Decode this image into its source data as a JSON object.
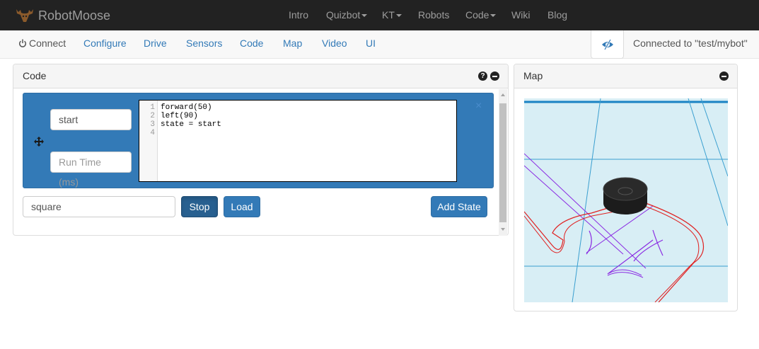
{
  "app": {
    "brand": "RobotMoose"
  },
  "topnav": {
    "intro": "Intro",
    "quizbot": "Quizbot",
    "kt": "KT",
    "robots": "Robots",
    "code": "Code",
    "wiki": "Wiki",
    "blog": "Blog"
  },
  "subnav": {
    "connect": "Connect",
    "configure": "Configure",
    "drive": "Drive",
    "sensors": "Sensors",
    "code": "Code",
    "map": "Map",
    "video": "Video",
    "ui": "UI",
    "status": "Connected to \"test/mybot\""
  },
  "code_panel": {
    "title": "Code",
    "state": {
      "name_value": "start",
      "runtime_placeholder": "Run Time (ms)",
      "code_lines": [
        {
          "no": "1",
          "text": "forward(50)"
        },
        {
          "no": "2",
          "text": "left(90)"
        },
        {
          "no": "3",
          "text": "state = start"
        },
        {
          "no": "4",
          "text": ""
        }
      ],
      "close_label": "×"
    },
    "program_name_value": "square",
    "stop_label": "Stop",
    "load_label": "Load",
    "add_state_label": "Add State",
    "help_glyph": "?"
  },
  "map_panel": {
    "title": "Map"
  },
  "colors": {
    "navbar_bg": "#222222",
    "link_blue": "#337ab7",
    "state_bg": "#337ab7",
    "map_bg": "#d8eef5",
    "map_grid": "#3a9fd0",
    "path_red": "#e02020",
    "path_purple": "#8a2be2"
  },
  "icons": {
    "brand": "moose-icon",
    "power": "power-icon",
    "eye": "eye-slash-icon",
    "move": "move-arrows-icon",
    "help": "question-circle-icon",
    "minimize": "minus-circle-icon"
  }
}
